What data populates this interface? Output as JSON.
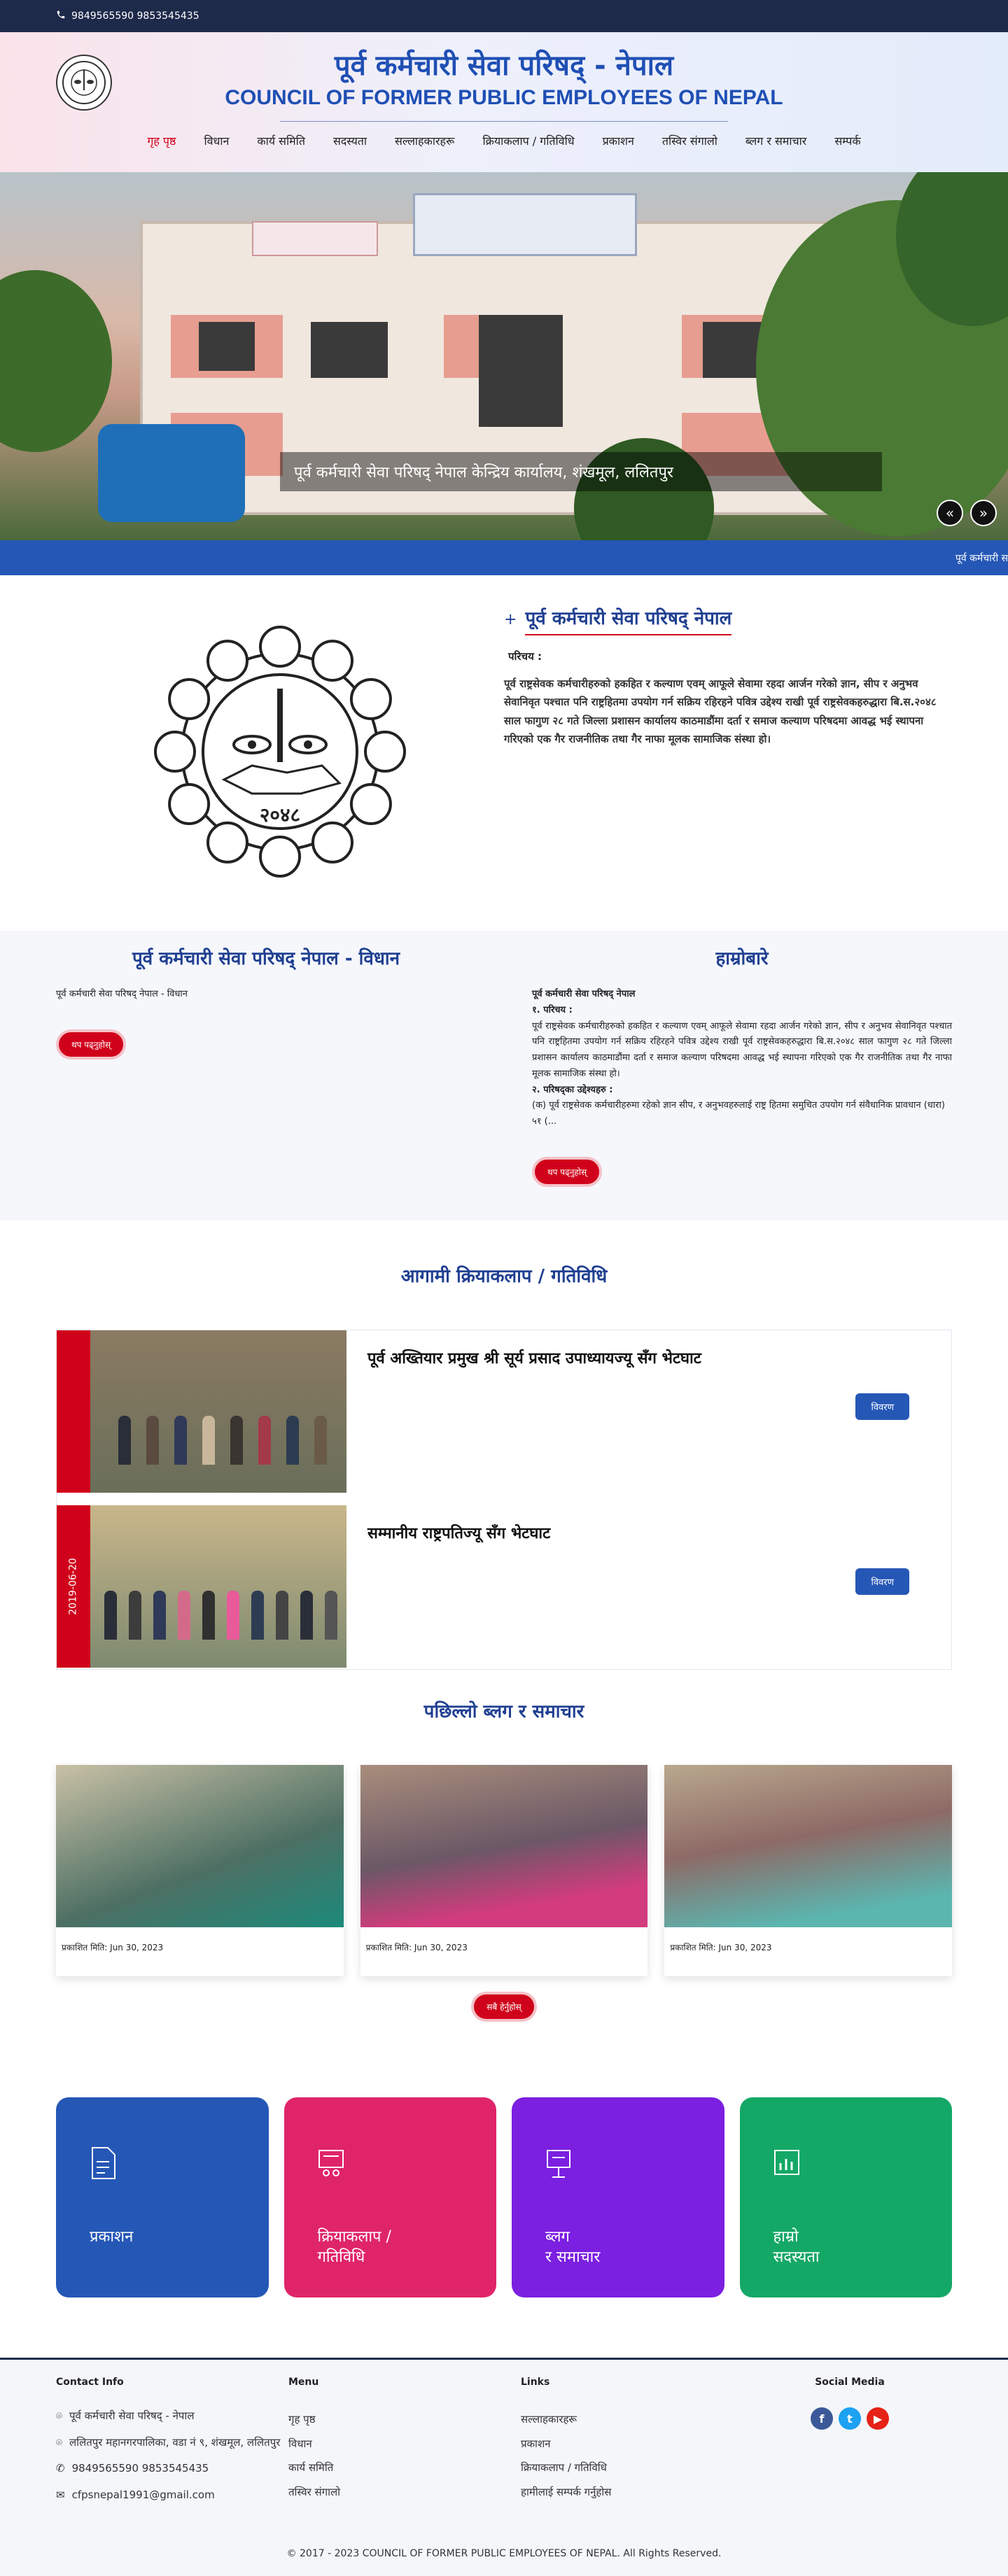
{
  "topbar": {
    "phone": "9849565590 9853545435",
    "icon": "phone-icon"
  },
  "header": {
    "title_np": "पूर्व कर्मचारी सेवा परिषद् - नेपाल",
    "title_en": "COUNCIL OF FORMER PUBLIC EMPLOYEES OF NEPAL",
    "nav": [
      "गृह पृष्ठ",
      "विधान",
      "कार्य समिति",
      "सदस्यता",
      "सल्लाहकारहरू",
      "क्रियाकलाप / गतिविधि",
      "प्रकाशन",
      "तस्विर संगालो",
      "ब्लग र समाचार",
      "सम्पर्क"
    ]
  },
  "hero": {
    "caption": "पूर्व कर्मचारी सेवा परिषद् नेपाल केन्द्रिय कार्यालय, शंखमूल, ललितपुर",
    "prev": "«",
    "next": "»"
  },
  "ticker": {
    "text": "पूर्व कर्मचारी स"
  },
  "about": {
    "title": "पूर्व कर्मचारी सेवा परिषद् नेपाल",
    "label": "परिचय :",
    "body": "पूर्व राष्ट्रसेवक कर्मचारीहरुको हकहित र कल्याण एवम् आफूले सेवामा रहदा आर्जन गरेको ज्ञान, सीप र अनुभव सेवानिवृत पश्चात पनि राष्ट्रहितमा उपयोग गर्न सक्रिय रहिरहने पवित्र उद्देश्य राखी पूर्व राष्ट्रसेवकहरुद्धारा बि.स.२०४८ साल फागुण २८ गते जिल्ला प्रशासन कार्यालय काठमाडौंमा दर्ता र समाज कल्याण परिषदमा आवद्ध भई स्थापना गरिएको एक गैर राजनीतिक तथा गैर नाफा मूलक सामाजिक संस्था हो।",
    "logo_text": "२०४८"
  },
  "vidhan": {
    "title": "पूर्व कर्मचारी सेवा परिषद् नेपाल - विधान",
    "text": "पूर्व कर्मचारी सेवा परिषद् नेपाल - विधान",
    "button": "थप पढ्नुहोस्"
  },
  "hamro": {
    "title": "हाम्रोबारे",
    "org": "पूर्व कर्मचारी सेवा परिषद् नेपाल",
    "h1": "१. परिचय :",
    "p1": "पूर्व राष्ट्रसेवक कर्मचारीहरुको हकहित र कल्याण एवम् आफूले सेवामा रहदा आर्जन गरेको ज्ञान, सीप र अनुभव सेवानिवृत पश्चात पनि राष्ट्रहितमा उपयोग गर्न सक्रिय रहिरहने पवित्र उद्देश्य राखी पूर्व राष्ट्रसेवकहरुद्धारा बि.स.२०४८ साल फागुण २८ गते जिल्ला प्रशासन कार्यालय काठमाडौंमा दर्ता र समाज कल्याण परिषदमा आवद्ध भई स्थापना गरिएको एक गैर राजनीतिक तथा गैर नाफा मूलक सामाजिक संस्था हो।",
    "h2": "२. परिषद्का उद्देश्यहरु :",
    "p2": "(क) पूर्व राष्ट्रसेवक कर्मचारीहरुमा रहेको ज्ञान सीप, र अनुभवहरुलाई राष्ट्र हितमा समुचित उपयोग गर्न संवैधानिक प्रावधान (धारा) ५१ (...",
    "button": "थप पढ्नुहोस्"
  },
  "events": {
    "title": "आगामी क्रियाकलाप / गतिविधि",
    "items": [
      {
        "date": "",
        "title": "पूर्व अख्तियार प्रमुख श्री सूर्य प्रसाद उपाध्यायज्यू सँग भेटघाट",
        "button": "विवरण"
      },
      {
        "date": "2019-06-20",
        "title": "सम्मानीय राष्ट्रपतिज्यू सँग भेटघाट",
        "button": "विवरण"
      }
    ]
  },
  "blogs": {
    "title": "पछिल्लो ब्लग र समाचार",
    "items": [
      {
        "meta": "प्रकाशित मिति: Jun 30, 2023"
      },
      {
        "meta": "प्रकाशित मिति: Jun 30, 2023"
      },
      {
        "meta": "प्रकाशित मिति: Jun 30, 2023"
      }
    ],
    "button": "सबै हेर्नुहोस्"
  },
  "tiles": [
    {
      "label": "प्रकाशन",
      "color": "#2557b6",
      "icon": "document-icon"
    },
    {
      "label": "क्रियाकलाप /\nगतिविधि",
      "color": "#e0246a",
      "icon": "presentation-icon"
    },
    {
      "label": "ब्लग\nर समाचार",
      "color": "#7b1fe0",
      "icon": "board-icon"
    },
    {
      "label": "हाम्रो\nसदस्यता",
      "color": "#14a866",
      "icon": "chart-icon"
    }
  ],
  "footer": {
    "contact_title": "Contact Info",
    "contact": [
      {
        "icon": "location-icon",
        "text": "पूर्व कर्मचारी सेवा परिषद् - नेपाल"
      },
      {
        "icon": "location-icon",
        "text": "ललितपुर महानगरपालिका, वडा नं ९, शंखमूल, ललितपुर"
      },
      {
        "icon": "phone-icon",
        "text": "9849565590 9853545435"
      },
      {
        "icon": "mail-icon",
        "text": "cfpsnepal1991@gmail.com"
      }
    ],
    "menu_title": "Menu",
    "menu": [
      "गृह पृष्ठ",
      "विधान",
      "कार्य समिति",
      "तस्विर संगालो"
    ],
    "links_title": "Links",
    "links": [
      "सल्लाहकारहरू",
      "प्रकाशन",
      "क्रियाकलाप / गतिविधि",
      "हामीलाई सम्पर्क गर्नुहोस"
    ],
    "social_title": "Social Media",
    "copyright": "© 2017 - 2023 COUNCIL OF FORMER PUBLIC EMPLOYEES OF NEPAL. All Rights Reserved."
  }
}
